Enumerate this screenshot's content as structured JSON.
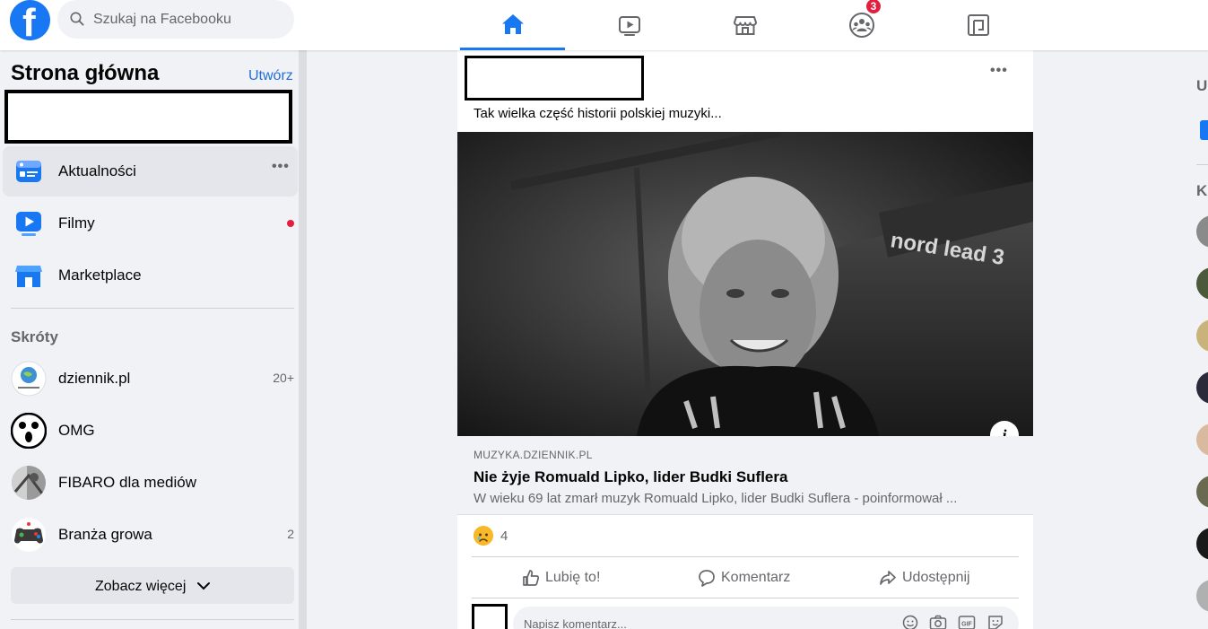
{
  "topbar": {
    "logo_letter": "f",
    "search_placeholder": "Szukaj na Facebooku",
    "groups_badge": "3"
  },
  "left": {
    "title": "Strona główna",
    "create_label": "Utwórz",
    "menu": [
      {
        "label": "Aktualności",
        "more": "•••"
      },
      {
        "label": "Filmy"
      },
      {
        "label": "Marketplace"
      }
    ],
    "shortcuts_title": "Skróty",
    "shortcuts": [
      {
        "label": "dziennik.pl",
        "count": "20+"
      },
      {
        "label": "OMG",
        "count": ""
      },
      {
        "label": "FIBARO dla mediów",
        "count": ""
      },
      {
        "label": "Branża growa",
        "count": "2"
      }
    ],
    "see_more_label": "Zobacz więcej"
  },
  "post": {
    "more": "•••",
    "text": "Tak wielka część historii polskiej muzyki...",
    "link_domain": "MUZYKA.DZIENNIK.PL",
    "link_title": "Nie żyje Romuald Lipko, lider Budki Suflera",
    "link_desc": "W wieku 69 lat zmarł muzyk Romuald Lipko, lider Budki Suflera - poinformował ...",
    "info_icon": "i",
    "reaction_count": "4",
    "like_label": "Lubię to!",
    "comment_label": "Komentarz",
    "share_label": "Udostępnij",
    "comment_placeholder": "Napisz komentarz...",
    "gif_label": "GIF",
    "keyboard_brand": "nord lead 3"
  },
  "right": {
    "letter_1": "U",
    "letter_2": "K"
  },
  "colors": {
    "brand_blue": "#1877f2",
    "badge_red": "#e41e3f",
    "link_blue": "#216fdb"
  }
}
